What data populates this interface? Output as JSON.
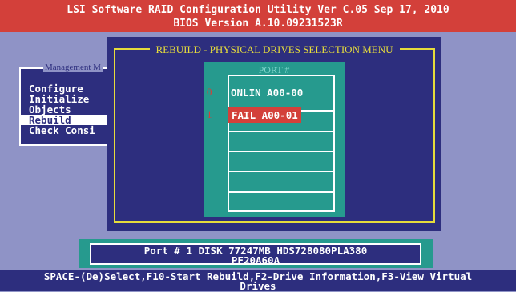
{
  "header": {
    "line1": "LSI Software RAID Configuration Utility Ver C.05 Sep 17, 2010",
    "line2": "BIOS Version   A.10.09231523R"
  },
  "management_menu": {
    "title": "Management M",
    "items": [
      "Configure",
      "Initialize",
      "Objects",
      "Rebuild",
      "Check Consi"
    ],
    "selected": "Rebuild"
  },
  "rebuild_menu": {
    "title": "REBUILD - PHYSICAL DRIVES SELECTION MENU",
    "column_header": "PORT #",
    "drives": [
      {
        "port": "0",
        "status": "ONLIN A00-00"
      },
      {
        "port": "1",
        "status": "FAIL  A00-01"
      }
    ]
  },
  "status": {
    "line1": "Port # 1 DISK    77247MB    HDS728080PLA380",
    "line2": "PF20A60A"
  },
  "footer": {
    "line1": "SPACE-(De)Select,F10-Start Rebuild,F2-Drive Information,F3-View Virtual",
    "line2": "Drives"
  },
  "colors": {
    "header_bg": "#d3403a",
    "background": "#8f93c6",
    "panel_bg": "#2d2e7e",
    "list_bg": "#269a8e",
    "frame": "#e6dc3c",
    "fail_highlight": "#d3403a"
  }
}
